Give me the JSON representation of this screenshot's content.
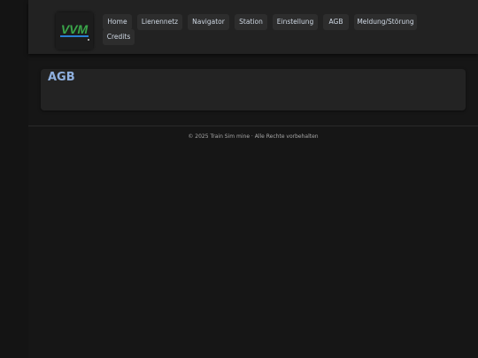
{
  "logo": {
    "text": "VVM",
    "colors": {
      "green": "#3aa64a",
      "blue": "#2a7fd4"
    }
  },
  "nav": {
    "items": [
      {
        "label": "Home"
      },
      {
        "label": "Lienennetz"
      },
      {
        "label": "Navigator"
      },
      {
        "label": "Station"
      },
      {
        "label": "Einstellung"
      },
      {
        "label": "AGB"
      },
      {
        "label": "Meldung/Störung"
      },
      {
        "label": "Credits"
      }
    ]
  },
  "main": {
    "title": "AGB"
  },
  "footer": {
    "text": "© 2025 Train Sim mine · Alle Rechte vorbehalten"
  }
}
